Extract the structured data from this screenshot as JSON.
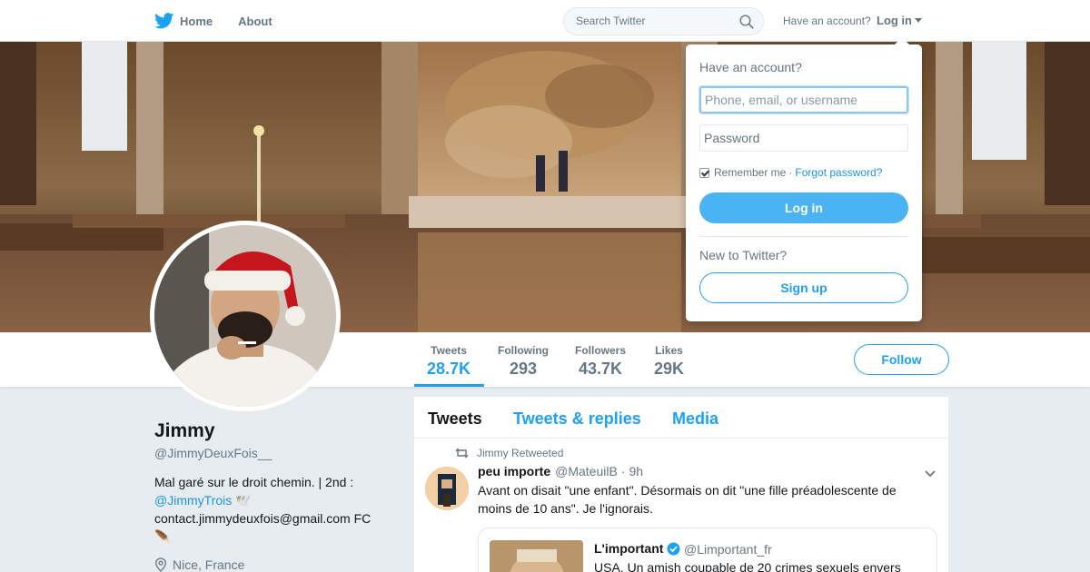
{
  "nav": {
    "home_label": "Home",
    "about_label": "About",
    "search_placeholder": "Search Twitter",
    "have_account": "Have an account?",
    "login_label": "Log in"
  },
  "stats": [
    {
      "label": "Tweets",
      "value": "28.7K"
    },
    {
      "label": "Following",
      "value": "293"
    },
    {
      "label": "Followers",
      "value": "43.7K"
    },
    {
      "label": "Likes",
      "value": "29K"
    }
  ],
  "follow_label": "Follow",
  "profile": {
    "name": "Jimmy",
    "handle": "@JimmyDeuxFois__",
    "bio_line1": "Mal garé sur le droit chemin. | 2nd :",
    "bio_mention": "@JimmyTrois",
    "bio_mention_emoji": "🕊️",
    "bio_line3": "contact.jimmydeuxfois@gmail.com FC",
    "bio_emoji": "🪶",
    "location": "Nice, France"
  },
  "timeline": {
    "tabs": [
      "Tweets",
      "Tweets & replies",
      "Media"
    ],
    "tweet": {
      "context": "Jimmy Retweeted",
      "name": "peu importe",
      "handle": "@MateuilB",
      "dot": "·",
      "time": "9h",
      "text": "Avant on disait \"une enfant\". Désormais on dit \"une fille préadolescente de moins de 10 ans\". Je l'ignorais.",
      "quote": {
        "name": "L'important",
        "handle": "@Limportant_fr",
        "text": "USA. Un amish coupable de 20 crimes sexuels envers"
      }
    }
  },
  "login_dropdown": {
    "title": "Have an account?",
    "username_placeholder": "Phone, email, or username",
    "password_placeholder": "Password",
    "remember_label": "Remember me",
    "separator": "·",
    "forgot_label": "Forgot password?",
    "login_button": "Log in",
    "new_label": "New to Twitter?",
    "signup_button": "Sign up"
  },
  "colors": {
    "accent": "#1da1f2",
    "login_button": "#4ab3f4",
    "background": "#e6ecf0"
  }
}
